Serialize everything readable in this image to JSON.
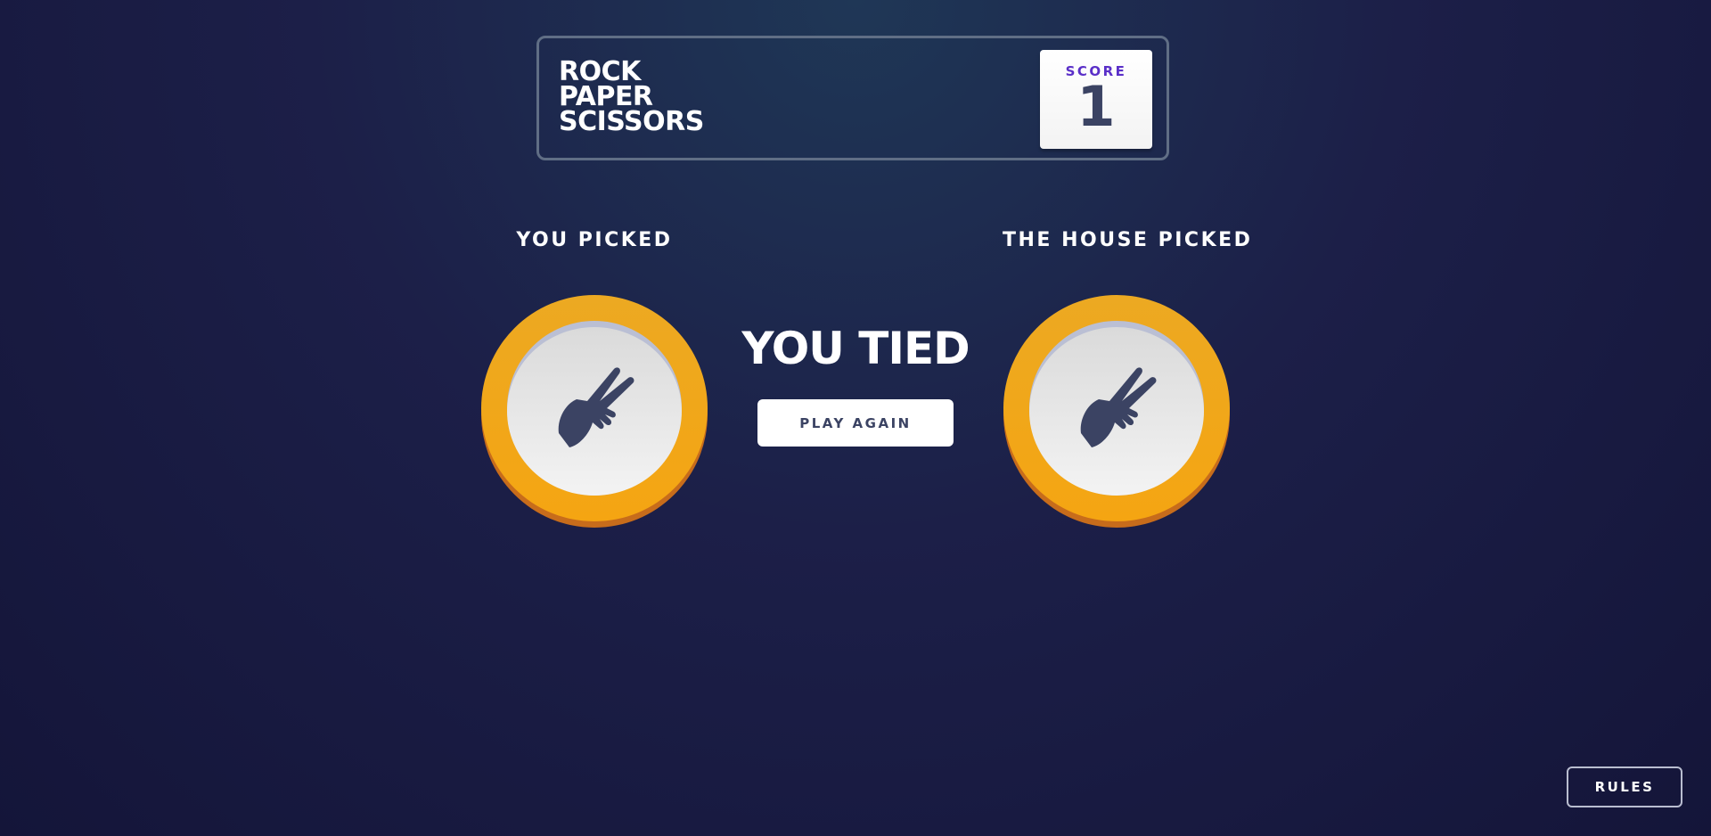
{
  "header": {
    "title_lines": [
      "ROCK",
      "PAPER",
      "SCISSORS"
    ],
    "score_label": "SCORE",
    "score_value": "1"
  },
  "game": {
    "player_label": "YOU PICKED",
    "house_label": "THE HOUSE PICKED",
    "player_pick": {
      "name": "scissors",
      "icon": "scissors-hand-icon",
      "ring_color": "#f5a512"
    },
    "house_pick": {
      "name": "scissors",
      "icon": "scissors-hand-icon",
      "ring_color": "#f5a512"
    },
    "result_text": "YOU TIED",
    "play_again_label": "PLAY AGAIN"
  },
  "footer": {
    "rules_label": "RULES"
  },
  "colors": {
    "background_top": "#1f3756",
    "background_bottom": "#141539",
    "score_label": "#5a2fc8",
    "dark_text": "#3b4363",
    "icon_fill": "#3b4363"
  }
}
